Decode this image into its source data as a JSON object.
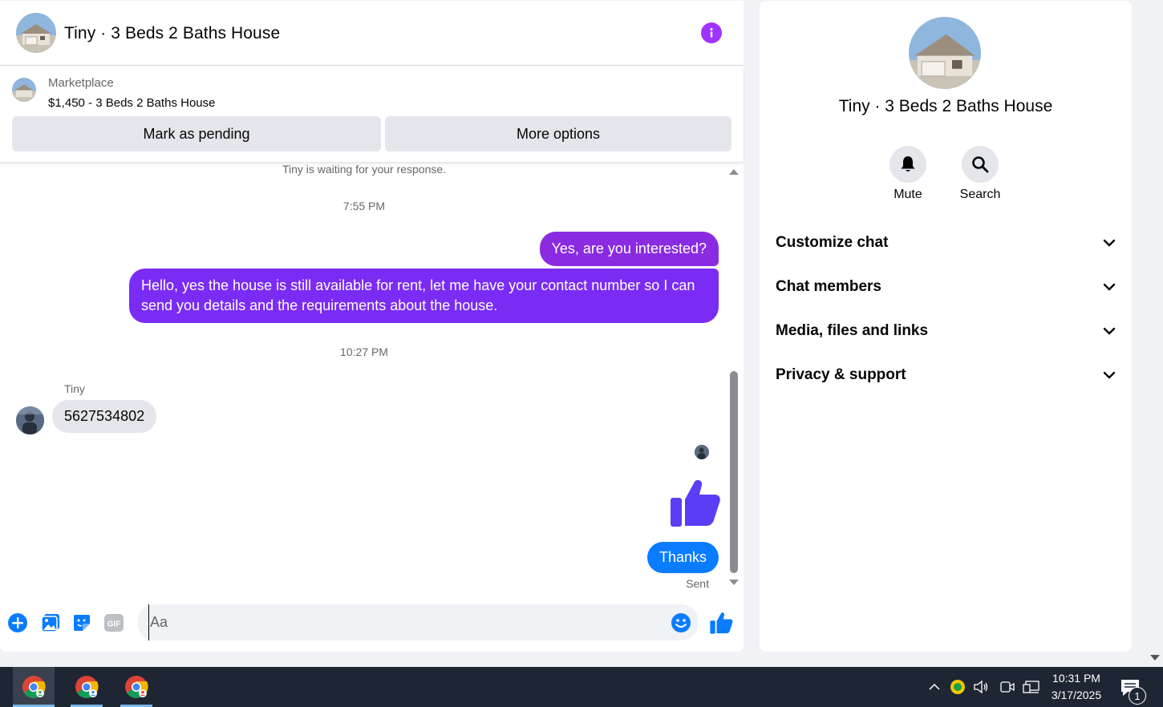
{
  "chat": {
    "title": "Tiny · 3 Beds 2 Baths House",
    "marketplace_label": "Marketplace",
    "listing": "$1,450 - 3 Beds 2 Baths House",
    "mark_pending_label": "Mark as pending",
    "more_options_label": "More options",
    "waiting_text": "Tiny is waiting for your response.",
    "messages": {
      "ts1": "7:55 PM",
      "out1": "Yes, are you interested?",
      "out2": "Hello, yes the house is still available for rent, let me have your contact number so I can send you details and the requirements about the house.",
      "ts2": "10:27 PM",
      "sender": "Tiny",
      "in1": "5627534802",
      "out3": "Thanks",
      "sent_status": "Sent"
    },
    "composer": {
      "placeholder": "Aa",
      "icons": [
        "plus-icon",
        "photo-icon",
        "sticker-icon",
        "gif-icon",
        "emoji-icon",
        "thumbs-up-icon"
      ],
      "gif_text": "GIF"
    }
  },
  "details": {
    "title": "Tiny · 3 Beds 2 Baths House",
    "mute_label": "Mute",
    "search_label": "Search",
    "sections": [
      {
        "label": "Customize chat"
      },
      {
        "label": "Chat members"
      },
      {
        "label": "Media, files and links"
      },
      {
        "label": "Privacy & support"
      }
    ]
  },
  "taskbar": {
    "time": "10:31 PM",
    "date": "3/17/2025",
    "notification_count": "1"
  },
  "colors": {
    "accent_purple": "#7a2cf5",
    "messenger_blue": "#0a7cff",
    "like_indigo": "#5b3df5",
    "info_purple": "#a033ff"
  }
}
